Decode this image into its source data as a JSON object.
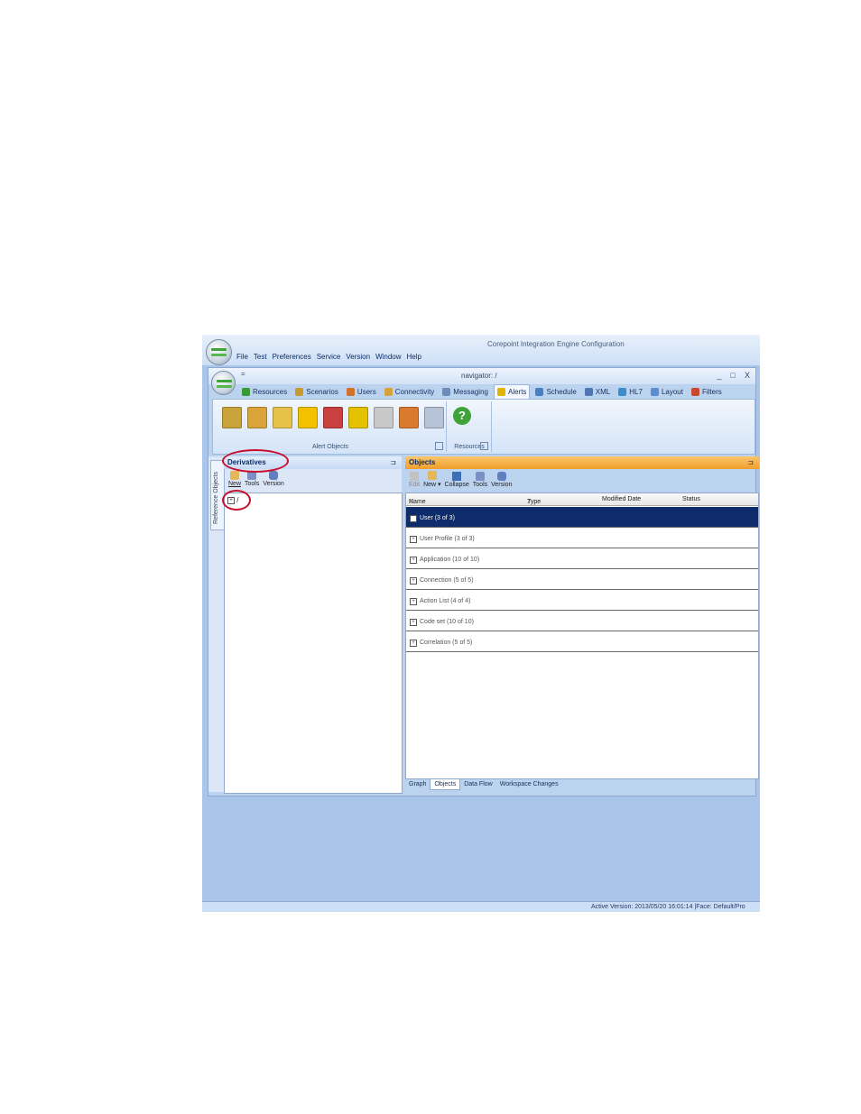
{
  "app": {
    "title": "Corepoint Integration Engine Configuration",
    "menu": [
      "File",
      "Test",
      "Preferences",
      "Service",
      "Version",
      "Window",
      "Help"
    ]
  },
  "doc_window": {
    "title": "navigator: /",
    "qat": "=",
    "controls": [
      "_",
      "□",
      "X"
    ]
  },
  "tabs": [
    {
      "label": "Resources",
      "icon": "resources-icon",
      "color": "#3a9a35"
    },
    {
      "label": "Scenarios",
      "icon": "scenarios-icon",
      "color": "#c99a2e"
    },
    {
      "label": "Users",
      "icon": "users-icon",
      "color": "#d2722a"
    },
    {
      "label": "Connectivity",
      "icon": "connectivity-icon",
      "color": "#d6a43a"
    },
    {
      "label": "Messaging",
      "icon": "messaging-icon",
      "color": "#6d8db8"
    },
    {
      "label": "Alerts",
      "icon": "alerts-icon",
      "color": "#e0b400",
      "active": true
    },
    {
      "label": "Schedule",
      "icon": "schedule-icon",
      "color": "#4a7fc1"
    },
    {
      "label": "XML",
      "icon": "xml-icon",
      "color": "#4f76b2"
    },
    {
      "label": "HL7",
      "icon": "hl7-icon",
      "color": "#3a8fc9"
    },
    {
      "label": "Layout",
      "icon": "layout-icon",
      "color": "#5b8fd1"
    },
    {
      "label": "Filters",
      "icon": "filters-icon",
      "color": "#c9482e"
    }
  ],
  "ribbon": {
    "groups": [
      {
        "label": "Alert Objects"
      },
      {
        "label": "Resources"
      }
    ],
    "alert_icons": [
      {
        "name": "alert-door-icon",
        "color": "#c9a43a"
      },
      {
        "name": "alert-calendar-icon",
        "color": "#d9a53a"
      },
      {
        "name": "alert-folder-icon",
        "color": "#e5c24a"
      },
      {
        "name": "alert-warning-icon",
        "color": "#f2c200"
      },
      {
        "name": "alert-thermometer-icon",
        "color": "#c94040"
      },
      {
        "name": "alert-flag-icon",
        "color": "#e5c200"
      },
      {
        "name": "alert-mail-icon",
        "color": "#c8c8c8"
      },
      {
        "name": "alert-user-icon",
        "color": "#d97a2e"
      },
      {
        "name": "alert-mail-list-icon",
        "color": "#b7c3d6"
      }
    ],
    "help_icon": {
      "name": "help-icon",
      "color": "#3fa33a",
      "glyph": "?"
    }
  },
  "left_panel": {
    "title": "Derivatives",
    "side_tab": "Reference Objects",
    "pin": "⊐",
    "toolbar": [
      "New",
      "Tools",
      "Version"
    ],
    "tree_root": "/"
  },
  "right_panel": {
    "title": "Objects",
    "pin": "⊐",
    "toolbar": [
      {
        "label": "Edit",
        "disabled": true
      },
      {
        "label": "New ▾",
        "disabled": false
      },
      {
        "label": "Collapse",
        "disabled": false
      },
      {
        "label": "Tools",
        "disabled": false
      },
      {
        "label": "Version",
        "disabled": false
      }
    ],
    "columns": [
      "Name",
      "Type",
      "Modified Date",
      "Status"
    ],
    "sort_glyph": "⁄",
    "groups": [
      {
        "label": "User (3 of 3)",
        "selected": true
      },
      {
        "label": "User Profile (3 of 3)"
      },
      {
        "label": "Application (10 of 10)"
      },
      {
        "label": "Connection (5 of 5)"
      },
      {
        "label": "Action List (4 of 4)"
      },
      {
        "label": "Code set (10 of 10)"
      },
      {
        "label": "Correlation (5 of 5)"
      }
    ],
    "bottom_tabs": [
      "Graph",
      "Objects",
      "Data Flow",
      "Workspace Changes"
    ],
    "active_bottom_tab": "Objects"
  },
  "status_bar": {
    "text": "Active Version: 2013/05/20 16:01:14 |Face: Default/Pro"
  },
  "colors": {
    "annotation": "#c8102e",
    "derivatives_header": "#0b2d66",
    "objects_header": "#f2a23a",
    "selected_row": "#0e2b6b"
  }
}
